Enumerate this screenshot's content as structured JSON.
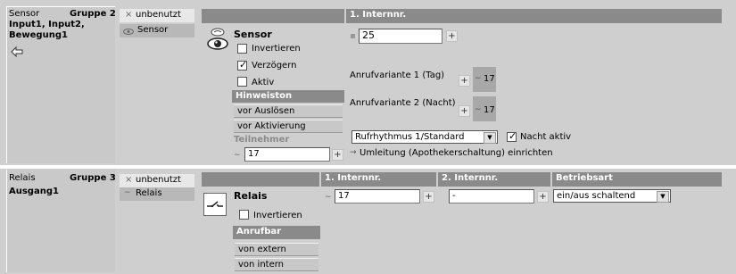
{
  "rows": [
    {
      "type_label": "Sensor",
      "group_label": "Gruppe 2",
      "title": "Input1, Input2, Bewegung1",
      "back_icon": "arrow-left-icon",
      "options": [
        "unbenutzt",
        "Sensor"
      ],
      "option_icons": [
        "x-icon",
        "eye-small-icon"
      ],
      "column_headers": [
        "1. Internnr."
      ],
      "device_name": "Sensor",
      "device_icon": "eye-icon",
      "checkboxes": [
        {
          "label": "Invertieren",
          "checked": false
        },
        {
          "label": "Verzögern",
          "checked": true
        },
        {
          "label": "Aktiv",
          "checked": false
        }
      ],
      "tone_header": "Hinweiston",
      "tone_items": [
        "vor Auslösen",
        "vor Aktivierung"
      ],
      "participant_label": "Teilnehmer",
      "participant_value": "17",
      "internnr_value": "25",
      "call_variant_day_label": "Anrufvariante 1 (Tag)",
      "call_variant_day_value": "17",
      "call_variant_night_label": "Anrufvariante 2 (Nacht)",
      "call_variant_night_value": "17",
      "ring_rhythm": "Rufrhythmus 1/Standard",
      "night_active_label": "Nacht aktiv",
      "night_active_checked": true,
      "redirect_link": "Umleitung (Apothekerschaltung) einrichten",
      "plus": "+"
    },
    {
      "type_label": "Relais",
      "group_label": "Gruppe 3",
      "title": "Ausgang1",
      "options": [
        "unbenutzt",
        "Relais"
      ],
      "option_icons": [
        "x-icon",
        "relay-small-icon"
      ],
      "column_headers": [
        "1. Internnr.",
        "2. Internnr.",
        "Betriebsart"
      ],
      "device_name": "Relais",
      "device_icon": "relay-switch-icon",
      "checkboxes": [
        {
          "label": "Invertieren",
          "checked": false
        }
      ],
      "call_header": "Anrufbar",
      "call_items": [
        "von extern",
        "von intern"
      ],
      "internnr1_value": "17",
      "internnr2_value": "-",
      "mode_value": "ein/aus schaltend",
      "plus": "+"
    }
  ]
}
